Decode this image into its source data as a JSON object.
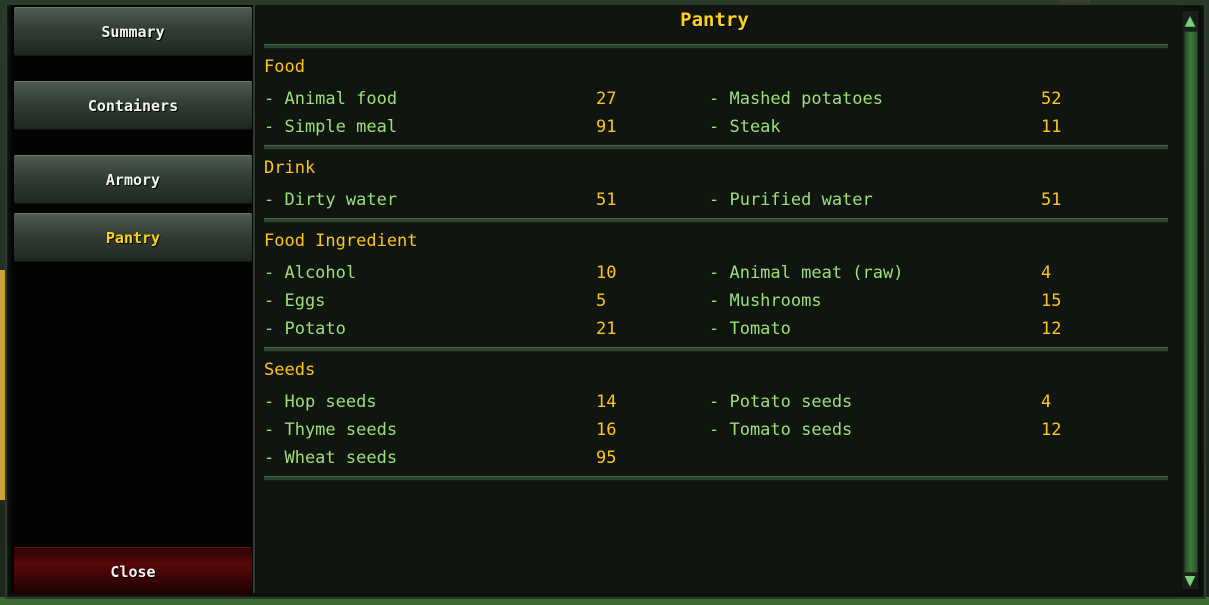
{
  "sidebar": {
    "buttons": [
      {
        "label": "Summary"
      },
      {
        "label": "Containers"
      },
      {
        "label": "Armory"
      },
      {
        "label": "Pantry"
      }
    ],
    "active": "Pantry",
    "close_label": "Close"
  },
  "main": {
    "title": "Pantry",
    "categories": [
      {
        "name": "Food",
        "items": [
          {
            "name": "- Animal food",
            "qty": "27"
          },
          {
            "name": "- Mashed potatoes",
            "qty": "52"
          },
          {
            "name": "- Simple meal",
            "qty": "91"
          },
          {
            "name": "- Steak",
            "qty": "11"
          }
        ]
      },
      {
        "name": "Drink",
        "items": [
          {
            "name": "- Dirty water",
            "qty": "51"
          },
          {
            "name": "- Purified water",
            "qty": "51"
          }
        ]
      },
      {
        "name": "Food Ingredient",
        "items": [
          {
            "name": "- Alcohol",
            "qty": "10"
          },
          {
            "name": "- Animal meat (raw)",
            "qty": "4"
          },
          {
            "name": "- Eggs",
            "qty": "5"
          },
          {
            "name": "- Mushrooms",
            "qty": "15"
          },
          {
            "name": "- Potato",
            "qty": "21"
          },
          {
            "name": "- Tomato",
            "qty": "12"
          }
        ]
      },
      {
        "name": "Seeds",
        "items": [
          {
            "name": "- Hop seeds",
            "qty": "14"
          },
          {
            "name": "- Potato seeds",
            "qty": "4"
          },
          {
            "name": "- Thyme seeds",
            "qty": "16"
          },
          {
            "name": "- Tomato seeds",
            "qty": "12"
          },
          {
            "name": "- Wheat seeds",
            "qty": "95"
          }
        ]
      }
    ]
  },
  "scrollbar": {
    "up_icon": "scroll-up-icon",
    "down_icon": "scroll-down-icon"
  },
  "colors": {
    "title": "#ffd21a",
    "category": "#ffc61a",
    "item_name": "#9ce07a",
    "quantity": "#ffc61a"
  }
}
